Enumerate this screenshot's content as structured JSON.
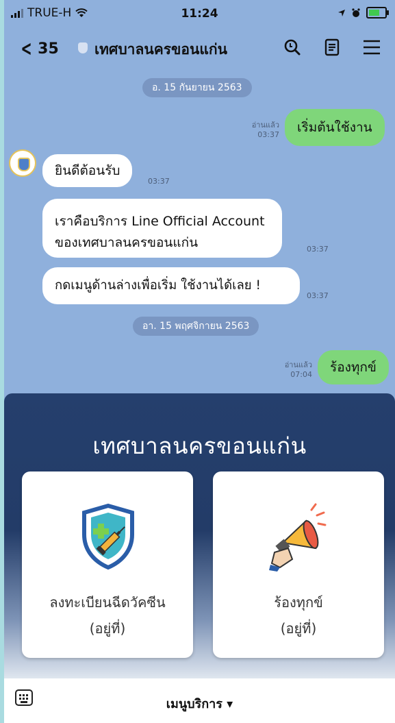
{
  "status": {
    "carrier": "TRUE-H",
    "time": "11:24"
  },
  "header": {
    "back_count": "35",
    "title": "เทศบาลนครขอนแก่น"
  },
  "chat": {
    "date1": "อ. 15 กันยายน 2563",
    "msg_user1": {
      "text": "เริ่มต้นใช้งาน",
      "read": "อ่านแล้ว",
      "time": "03:37"
    },
    "bot_msgs": [
      {
        "text": "ยินดีต้อนรับ",
        "time": "03:37"
      },
      {
        "line1": "เราคือบริการ Line Official Account",
        "line2": "ของเทศบาลนครขอนแก่น",
        "time": "03:37"
      },
      {
        "text": "กดเมนูด้านล่างเพื่อเริ่ม ใช้งานได้เลย !",
        "time": "03:37"
      }
    ],
    "date2": "อา. 15 พฤศจิกายน 2563",
    "msg_user2": {
      "text": "ร้องทุกข์",
      "read": "อ่านแล้ว",
      "time": "07:04"
    }
  },
  "richmenu": {
    "title": "เทศบาลนครขอนแก่น",
    "cards": [
      {
        "line1": "ลงทะเบียนฉีดวัคซีน",
        "line2": "(อยู่ที่)",
        "icon": "vaccine-shield-icon"
      },
      {
        "line1": "ร้องทุกข์",
        "line2": "(อยู่ที่)",
        "icon": "megaphone-icon"
      }
    ]
  },
  "bottombar": {
    "menu_label": "เมนูบริการ ▾"
  },
  "colors": {
    "chat_bg": "#8fb0dc",
    "user_bubble": "#7fd67a",
    "menu_bg": "#253f6d"
  }
}
